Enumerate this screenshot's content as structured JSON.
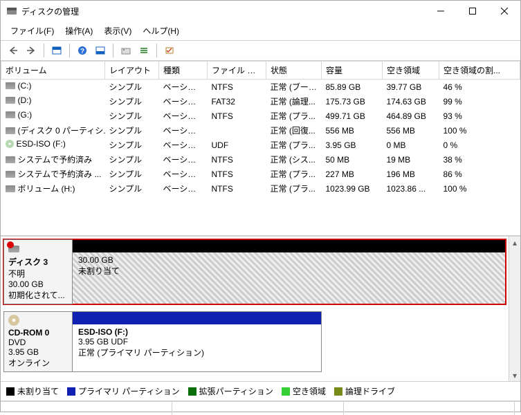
{
  "window": {
    "title": "ディスクの管理",
    "menus": [
      "ファイル(F)",
      "操作(A)",
      "表示(V)",
      "ヘルプ(H)"
    ]
  },
  "columns": {
    "volume": "ボリューム",
    "layout": "レイアウト",
    "type": "種類",
    "fs": "ファイル システム",
    "status": "状態",
    "capacity": "容量",
    "free": "空き領域",
    "freepct": "空き領域の割..."
  },
  "volumes": [
    {
      "icon": "drive",
      "name": "(C:)",
      "layout": "シンプル",
      "type": "ベーシック",
      "fs": "NTFS",
      "status": "正常 (ブート...",
      "cap": "85.89 GB",
      "free": "39.77 GB",
      "pct": "46 %"
    },
    {
      "icon": "drive",
      "name": "(D:)",
      "layout": "シンプル",
      "type": "ベーシック",
      "fs": "FAT32",
      "status": "正常 (論理...",
      "cap": "175.73 GB",
      "free": "174.63 GB",
      "pct": "99 %"
    },
    {
      "icon": "drive",
      "name": "(G:)",
      "layout": "シンプル",
      "type": "ベーシック",
      "fs": "NTFS",
      "status": "正常 (プラ...",
      "cap": "499.71 GB",
      "free": "464.89 GB",
      "pct": "93 %"
    },
    {
      "icon": "drive",
      "name": "(ディスク 0 パーティシ...",
      "layout": "シンプル",
      "type": "ベーシック",
      "fs": "",
      "status": "正常 (回復...",
      "cap": "556 MB",
      "free": "556 MB",
      "pct": "100 %"
    },
    {
      "icon": "cd",
      "name": "ESD-ISO (F:)",
      "layout": "シンプル",
      "type": "ベーシック",
      "fs": "UDF",
      "status": "正常 (プラ...",
      "cap": "3.95 GB",
      "free": "0 MB",
      "pct": "0 %"
    },
    {
      "icon": "drive",
      "name": "システムで予約済み",
      "layout": "シンプル",
      "type": "ベーシック",
      "fs": "NTFS",
      "status": "正常 (シス...",
      "cap": "50 MB",
      "free": "19 MB",
      "pct": "38 %"
    },
    {
      "icon": "drive",
      "name": "システムで予約済み ...",
      "layout": "シンプル",
      "type": "ベーシック",
      "fs": "NTFS",
      "status": "正常 (プラ...",
      "cap": "227 MB",
      "free": "196 MB",
      "pct": "86 %"
    },
    {
      "icon": "drive",
      "name": "ボリューム (H:)",
      "layout": "シンプル",
      "type": "ベーシック",
      "fs": "NTFS",
      "status": "正常 (プラ...",
      "cap": "1023.99 GB",
      "free": "1023.86 ...",
      "pct": "100 %"
    }
  ],
  "disk3": {
    "title": "ディスク 3",
    "kind": "不明",
    "size": "30.00 GB",
    "state": "初期化されて...",
    "part_size": "30.00 GB",
    "part_state": "未割り当て"
  },
  "cdrom0": {
    "title": "CD-ROM 0",
    "kind": "DVD",
    "size": "3.95 GB",
    "state": "オンライン",
    "part_name": "ESD-ISO (F:)",
    "part_sub": "3.95 GB UDF",
    "part_status": "正常 (プライマリ パーティション)"
  },
  "legend": {
    "unalloc": "未割り当て",
    "primary": "プライマリ パーティション",
    "extended": "拡張パーティション",
    "free": "空き領域",
    "logical": "論理ドライブ"
  }
}
